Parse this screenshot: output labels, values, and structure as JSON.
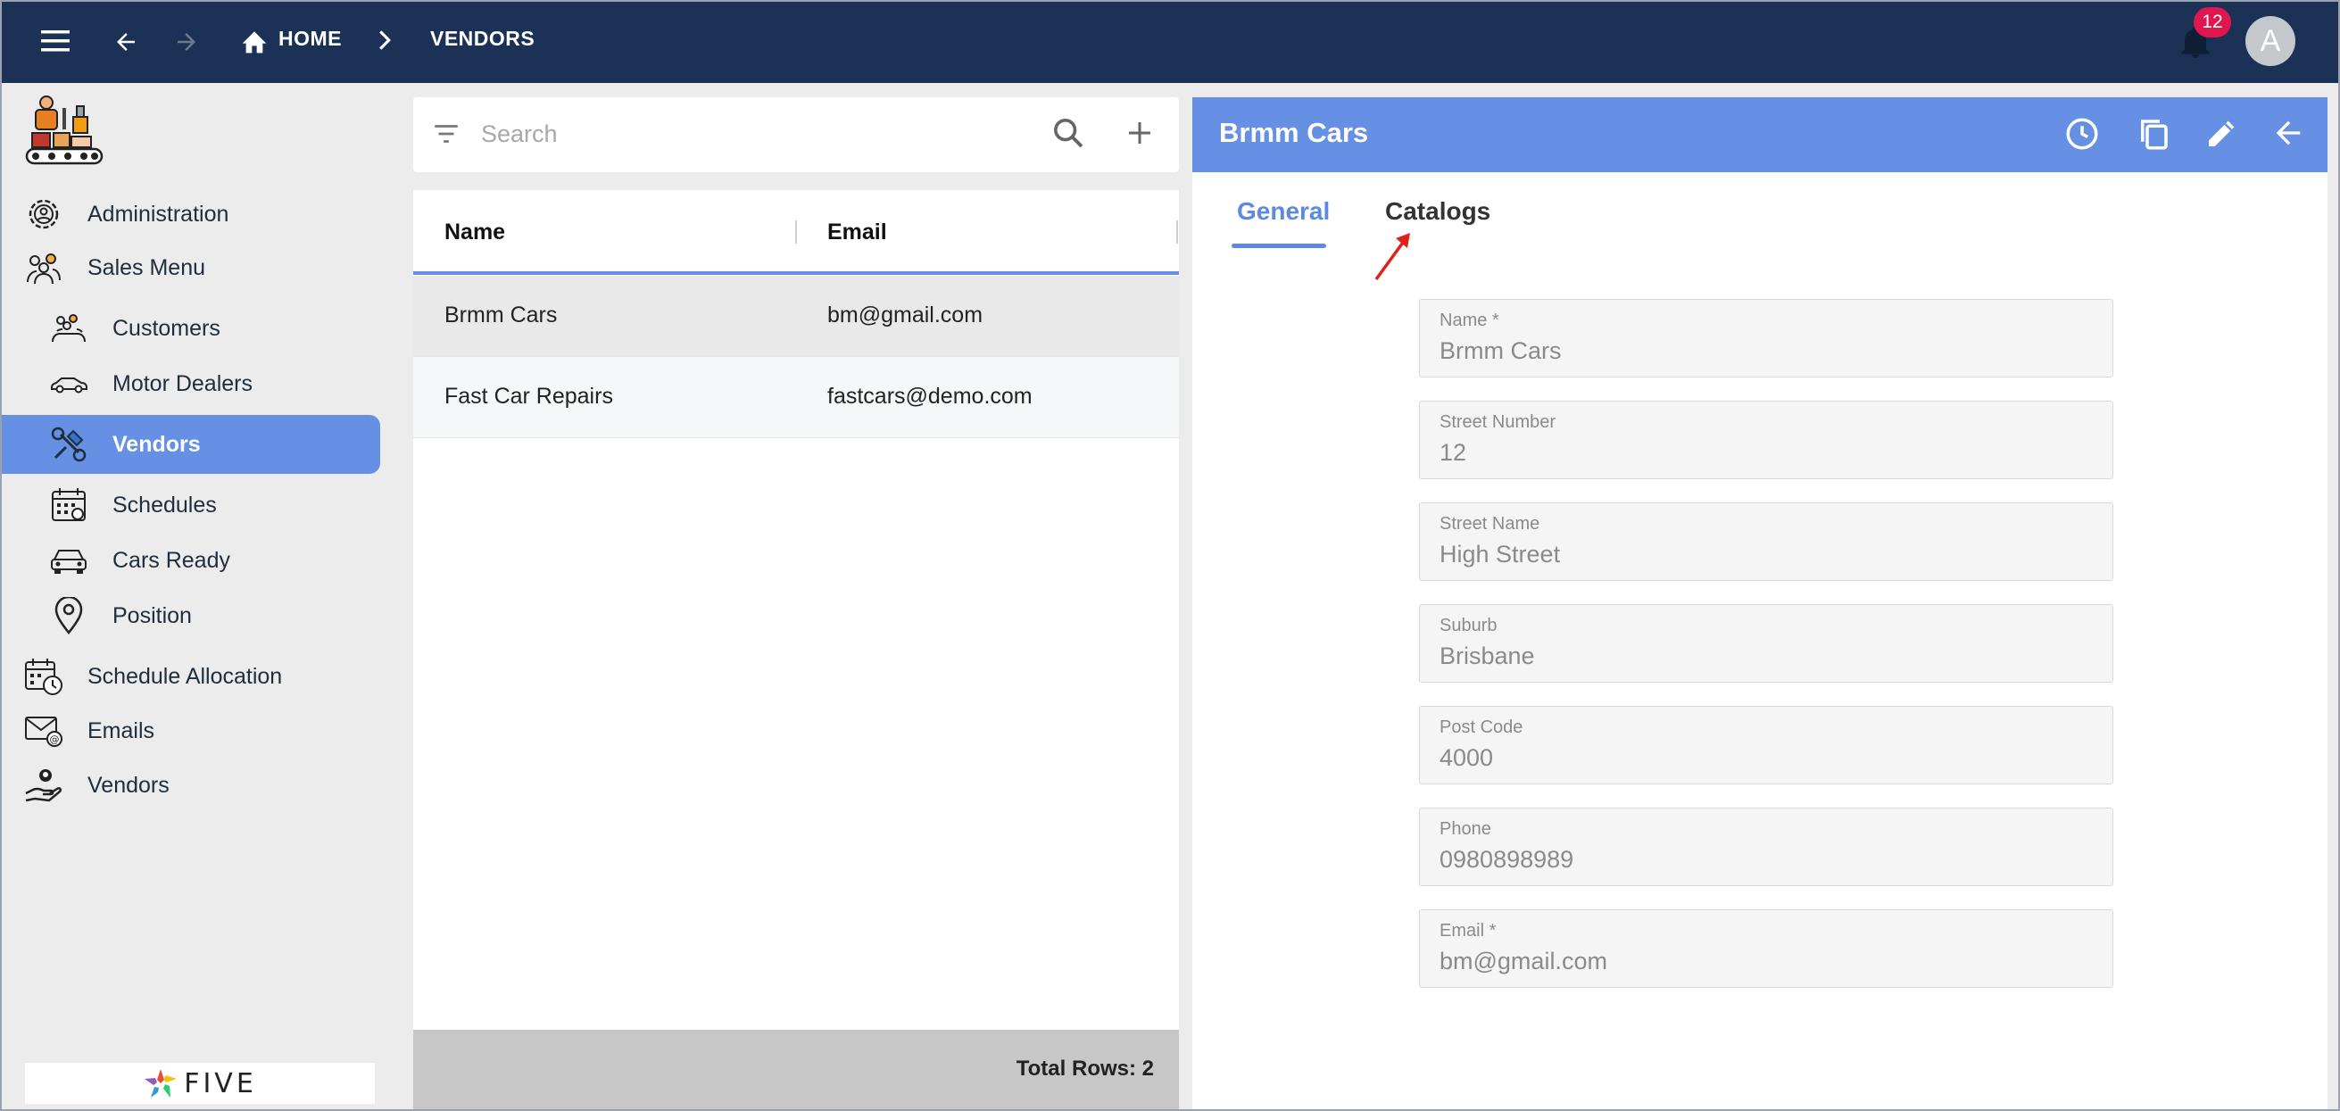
{
  "topbar": {
    "home_label": "HOME",
    "current_label": "VENDORS",
    "notification_count": "12",
    "avatar_initial": "A"
  },
  "sidebar": {
    "items": [
      {
        "label": "Administration",
        "icon": "administration-gear-icon"
      },
      {
        "label": "Sales Menu",
        "icon": "group-people-icon"
      },
      {
        "label": "Customers",
        "icon": "customers-icon"
      },
      {
        "label": "Motor Dealers",
        "icon": "car-outline-icon"
      },
      {
        "label": "Vendors",
        "icon": "vendor-tools-icon",
        "active": true
      },
      {
        "label": "Schedules",
        "icon": "calendar-icon"
      },
      {
        "label": "Cars Ready",
        "icon": "car-front-icon"
      },
      {
        "label": "Position",
        "icon": "map-pin-icon"
      },
      {
        "label": "Schedule Allocation",
        "icon": "calendar-clock-icon"
      },
      {
        "label": "Emails",
        "icon": "email-at-icon"
      },
      {
        "label": "Vendors",
        "icon": "hand-person-icon"
      }
    ],
    "footer_logo_text": "FIVE"
  },
  "list": {
    "search_placeholder": "Search",
    "columns": [
      "Name",
      "Email"
    ],
    "rows": [
      {
        "name": "Brmm Cars",
        "email": "bm@gmail.com"
      },
      {
        "name": "Fast Car Repairs",
        "email": "fastcars@demo.com"
      }
    ],
    "total_rows_label": "Total Rows: 2"
  },
  "form": {
    "title": "Brmm Cars",
    "tabs": [
      "General",
      "Catalogs"
    ],
    "fields": [
      {
        "label": "Name *",
        "value": "Brmm Cars"
      },
      {
        "label": "Street Number",
        "value": "12"
      },
      {
        "label": "Street Name",
        "value": "High Street"
      },
      {
        "label": "Suburb",
        "value": "Brisbane"
      },
      {
        "label": "Post Code",
        "value": "4000"
      },
      {
        "label": "Phone",
        "value": "0980898989"
      },
      {
        "label": "Email *",
        "value": "bm@gmail.com"
      }
    ]
  },
  "colors": {
    "topbar": "#1b3256",
    "accent": "#6590e3",
    "badge": "#e0174f",
    "annotation": "#e0201b"
  }
}
